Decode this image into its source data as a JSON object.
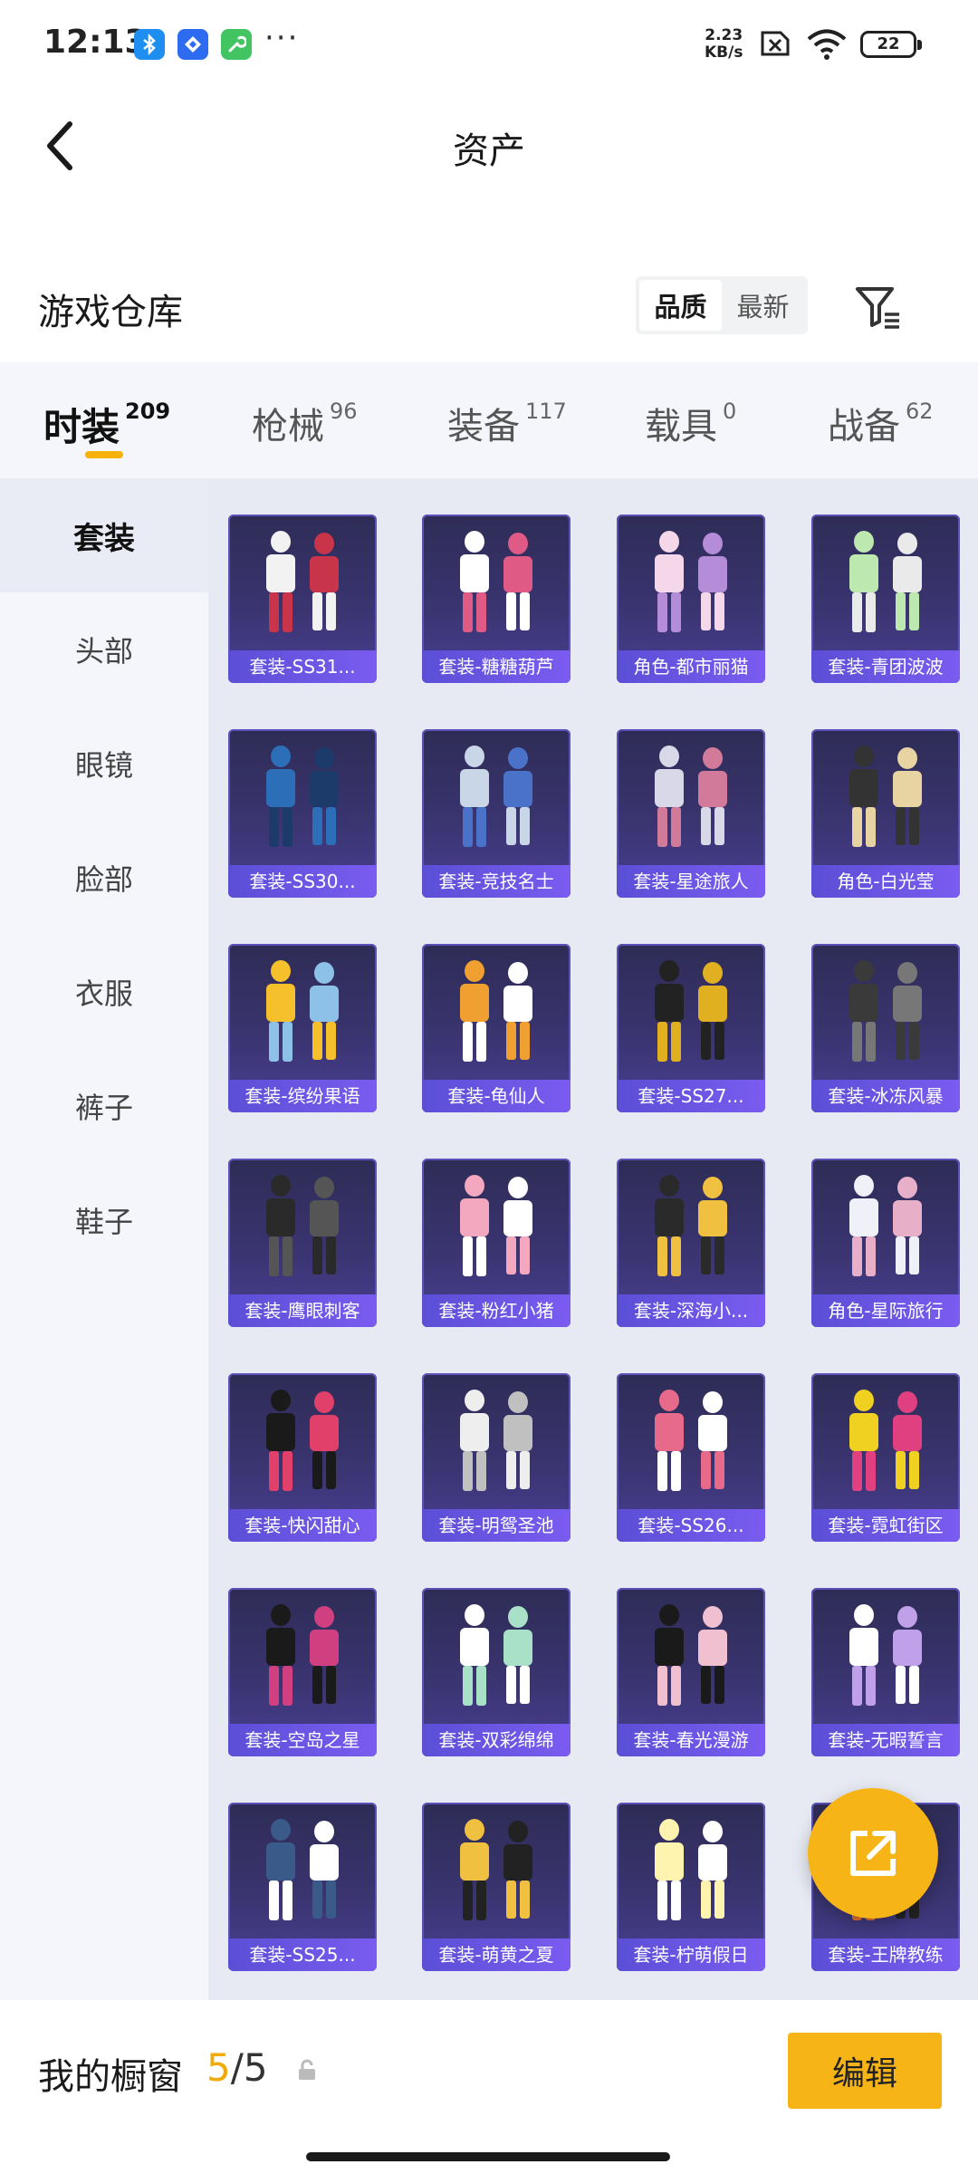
{
  "status_bar": {
    "time": "12:13",
    "net_speed_value": "2.23",
    "net_speed_unit": "KB/s",
    "battery": "22",
    "more": "···",
    "app_icons": [
      "bluetooth-icon",
      "app-diamond-icon",
      "app-wrench-icon"
    ]
  },
  "header": {
    "title": "资产"
  },
  "warehouse": {
    "title": "游戏仓库",
    "sort_options": [
      "品质",
      "最新"
    ],
    "active_sort": "品质"
  },
  "tabs": [
    {
      "label": "时装",
      "count": "209",
      "active": true
    },
    {
      "label": "枪械",
      "count": "96",
      "active": false
    },
    {
      "label": "装备",
      "count": "117",
      "active": false
    },
    {
      "label": "载具",
      "count": "0",
      "active": false
    },
    {
      "label": "战备",
      "count": "62",
      "active": false
    }
  ],
  "sidebar": {
    "items": [
      {
        "label": "套装",
        "active": true
      },
      {
        "label": "头部",
        "active": false
      },
      {
        "label": "眼镜",
        "active": false
      },
      {
        "label": "脸部",
        "active": false
      },
      {
        "label": "衣服",
        "active": false
      },
      {
        "label": "裤子",
        "active": false
      },
      {
        "label": "鞋子",
        "active": false
      }
    ]
  },
  "grid": {
    "items": [
      {
        "label": "套装-SS31..."
      },
      {
        "label": "套装-糖糖葫芦"
      },
      {
        "label": "角色-都市丽猫"
      },
      {
        "label": "套装-青团波波"
      },
      {
        "label": "套装-SS30..."
      },
      {
        "label": "套装-竞技名士"
      },
      {
        "label": "套装-星途旅人"
      },
      {
        "label": "角色-白光莹"
      },
      {
        "label": "套装-缤纷果语"
      },
      {
        "label": "套装-龟仙人"
      },
      {
        "label": "套装-SS27..."
      },
      {
        "label": "套装-冰冻风暴"
      },
      {
        "label": "套装-鹰眼刺客"
      },
      {
        "label": "套装-粉红小猪"
      },
      {
        "label": "套装-深海小..."
      },
      {
        "label": "角色-星际旅行"
      },
      {
        "label": "套装-快闪甜心"
      },
      {
        "label": "套装-明鸳圣池"
      },
      {
        "label": "套装-SS26..."
      },
      {
        "label": "套装-霓虹街区"
      },
      {
        "label": "套装-空岛之星"
      },
      {
        "label": "套装-双彩绵绵"
      },
      {
        "label": "套装-春光漫游"
      },
      {
        "label": "套装-无暇誓言"
      },
      {
        "label": "套装-SS25..."
      },
      {
        "label": "套装-萌黄之夏"
      },
      {
        "label": "套装-柠萌假日"
      },
      {
        "label": "套装-王牌教练"
      }
    ]
  },
  "bottom_bar": {
    "window_label": "我的橱窗",
    "used": "5",
    "separator": "/",
    "total": "5",
    "edit_label": "编辑"
  },
  "colors": {
    "accent": "#f7b416",
    "card_label": "#6a56e6",
    "card_bg": "#3a3470"
  }
}
